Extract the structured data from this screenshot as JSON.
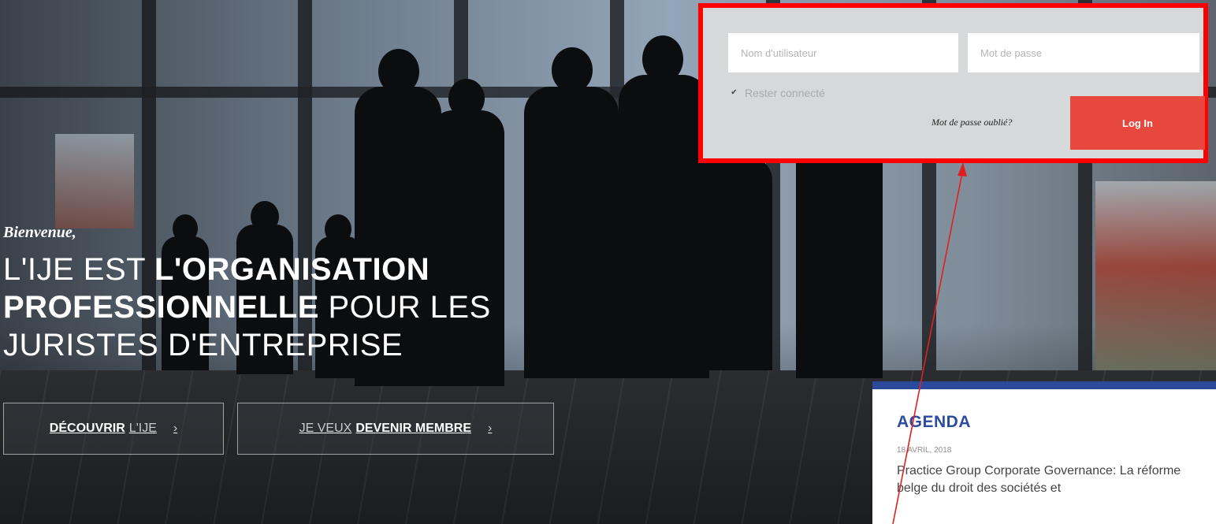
{
  "login": {
    "username_placeholder": "Nom d'utilisateur",
    "password_placeholder": "Mot de passe",
    "remember_label": "Rester connecté",
    "remember_checked": true,
    "forgot_label": "Mot de passe oublié?",
    "submit_label": "Log In"
  },
  "hero": {
    "greeting": "Bienvenue,",
    "headline": {
      "part1": "L'IJE EST ",
      "part2_bold": "L'ORGANISATION PROFESSIONNELLE",
      "part3": " POUR LES JURISTES D'ENTREPRISE"
    }
  },
  "cta": {
    "discover": {
      "bold": "DÉCOUVRIR",
      "light": "L'IJE"
    },
    "member": {
      "light": "JE VEUX",
      "bold": "DEVENIR MEMBRE"
    },
    "chevron": "›"
  },
  "agenda": {
    "title": "AGENDA",
    "date": "18 AVRIL, 2018",
    "event_title": "Practice Group Corporate Governance: La réforme belge du droit des sociétés et"
  },
  "colors": {
    "login_button": "#e8473d",
    "highlight_border": "#ff0000",
    "agenda_accent": "#2b4a9c"
  }
}
